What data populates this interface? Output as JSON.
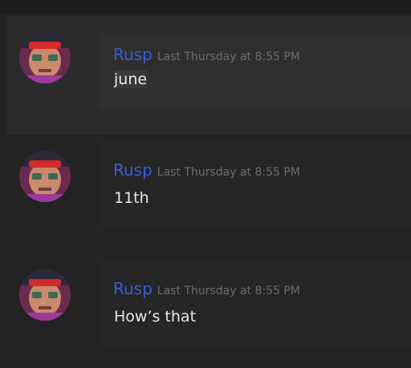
{
  "messages": [
    {
      "username": "Rusp",
      "timestamp": "Last Thursday at 8:55 PM",
      "text": "june",
      "avatar_icon": "user-avatar-icon"
    },
    {
      "username": "Rusp",
      "timestamp": "Last Thursday at 8:55 PM",
      "text": "11th",
      "avatar_icon": "user-avatar-icon"
    },
    {
      "username": "Rusp",
      "timestamp": "Last Thursday at 8:55 PM",
      "text": "How’s that",
      "avatar_icon": "user-avatar-icon"
    }
  ],
  "colors": {
    "background": "#232323",
    "username": "#3b5bd6",
    "timestamp": "#6c6c6c",
    "text": "#e6e6e6"
  }
}
